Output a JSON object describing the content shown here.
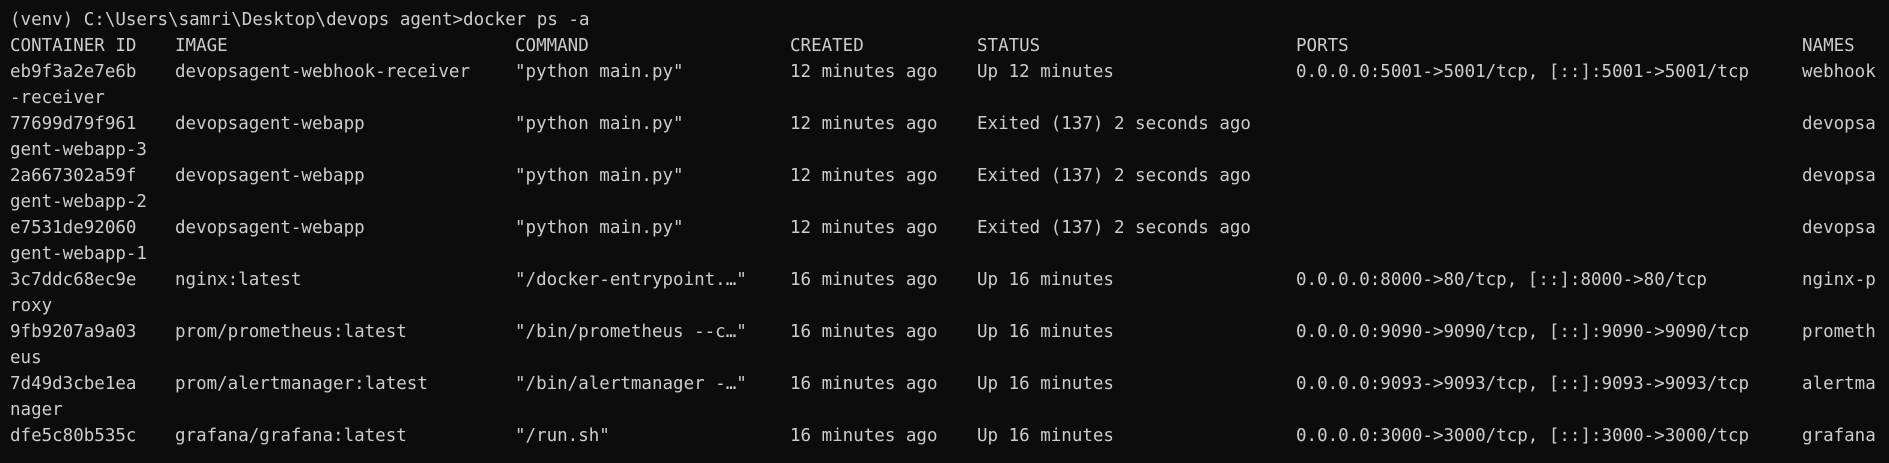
{
  "terminal": {
    "prompt": "(venv) C:\\Users\\samri\\Desktop\\devops agent>",
    "command": "docker ps -a",
    "headers": {
      "container_id": "CONTAINER ID",
      "image": "IMAGE",
      "command": "COMMAND",
      "created": "CREATED",
      "status": "STATUS",
      "ports": "PORTS",
      "names": "NAMES"
    },
    "rows": [
      {
        "container_id": "eb9f3a2e7e6b",
        "image": "devopsagent-webhook-receiver",
        "command": "\"python main.py\"",
        "created": "12 minutes ago",
        "status": "Up 12 minutes",
        "ports": "0.0.0.0:5001->5001/tcp, [::]:5001->5001/tcp",
        "names_visible": "webhook",
        "names_wrap": "-receiver"
      },
      {
        "container_id": "77699d79f961",
        "image": "devopsagent-webapp",
        "command": "\"python main.py\"",
        "created": "12 minutes ago",
        "status": "Exited (137) 2 seconds ago",
        "ports": "",
        "names_visible": "devopsa",
        "names_wrap": "gent-webapp-3"
      },
      {
        "container_id": "2a667302a59f",
        "image": "devopsagent-webapp",
        "command": "\"python main.py\"",
        "created": "12 minutes ago",
        "status": "Exited (137) 2 seconds ago",
        "ports": "",
        "names_visible": "devopsa",
        "names_wrap": "gent-webapp-2"
      },
      {
        "container_id": "e7531de92060",
        "image": "devopsagent-webapp",
        "command": "\"python main.py\"",
        "created": "12 minutes ago",
        "status": "Exited (137) 2 seconds ago",
        "ports": "",
        "names_visible": "devopsa",
        "names_wrap": "gent-webapp-1"
      },
      {
        "container_id": "3c7ddc68ec9e",
        "image": "nginx:latest",
        "command": "\"/docker-entrypoint.…\"",
        "created": "16 minutes ago",
        "status": "Up 16 minutes",
        "ports": "0.0.0.0:8000->80/tcp, [::]:8000->80/tcp",
        "names_visible": "nginx-p",
        "names_wrap": "roxy"
      },
      {
        "container_id": "9fb9207a9a03",
        "image": "prom/prometheus:latest",
        "command": "\"/bin/prometheus --c…\"",
        "created": "16 minutes ago",
        "status": "Up 16 minutes",
        "ports": "0.0.0.0:9090->9090/tcp, [::]:9090->9090/tcp",
        "names_visible": "prometh",
        "names_wrap": "eus"
      },
      {
        "container_id": "7d49d3cbe1ea",
        "image": "prom/alertmanager:latest",
        "command": "\"/bin/alertmanager -…\"",
        "created": "16 minutes ago",
        "status": "Up 16 minutes",
        "ports": "0.0.0.0:9093->9093/tcp, [::]:9093->9093/tcp",
        "names_visible": "alertma",
        "names_wrap": "nager"
      },
      {
        "container_id": "dfe5c80b535c",
        "image": "grafana/grafana:latest",
        "command": "\"/run.sh\"",
        "created": "16 minutes ago",
        "status": "Up 16 minutes",
        "ports": "0.0.0.0:3000->3000/tcp, [::]:3000->3000/tcp",
        "names_visible": "grafana",
        "names_wrap": ""
      }
    ],
    "colors": {
      "background": "#0c0c0c",
      "foreground": "#cccccc"
    }
  }
}
